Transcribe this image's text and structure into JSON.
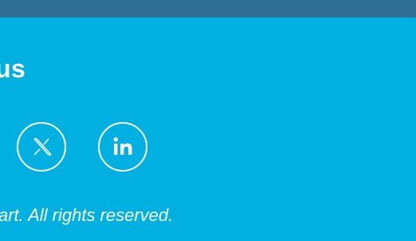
{
  "colors": {
    "top_bar": "#2f6f93",
    "background": "#00b0e0",
    "foreground": "#ffffff"
  },
  "footer": {
    "heading": "us",
    "social_links": [
      {
        "name": "X",
        "icon": "x-icon"
      },
      {
        "name": "LinkedIn",
        "icon": "linkedin-icon",
        "glyph": "in"
      }
    ],
    "copyright": "art. All rights reserved."
  }
}
